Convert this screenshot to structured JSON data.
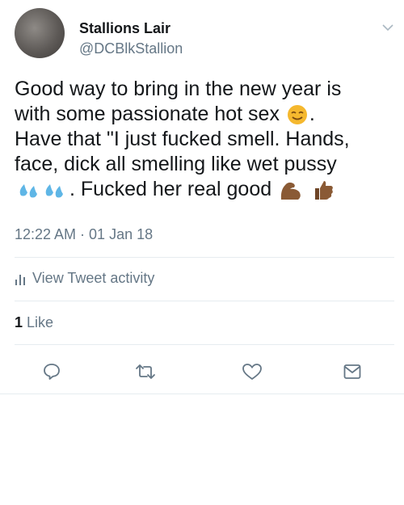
{
  "tweet": {
    "display_name": "Stallions Lair",
    "handle": "@DCBlkStallion",
    "text_line1": "Good way to bring in the new year is",
    "text_line2": "with some passionate hot sex",
    "text_line2_end": ".",
    "text_line3": "Have that \"I just fucked smell. Hands,",
    "text_line4": "face, dick all smelling like wet pussy",
    "text_line5": ". Fucked her real good",
    "timestamp": "12:22 AM · 01 Jan 18",
    "activity_label": "View Tweet activity",
    "like_count": "1",
    "like_label": " Like"
  },
  "icons": {
    "smile": "smiling-face-icon",
    "droplets": "sweat-droplets-icon",
    "flexed": "flexed-biceps-icon",
    "thumbs": "thumbs-up-icon",
    "reply": "reply-icon",
    "retweet": "retweet-icon",
    "like": "heart-icon",
    "dm": "envelope-icon",
    "chevron": "chevron-down-icon",
    "activity": "bar-chart-icon"
  },
  "colors": {
    "text": "#14171a",
    "secondary": "#657786",
    "emoji_yellow": "#f5b82e",
    "droplet_blue": "#5fb6e6",
    "skin_brown": "#8a5a35"
  }
}
